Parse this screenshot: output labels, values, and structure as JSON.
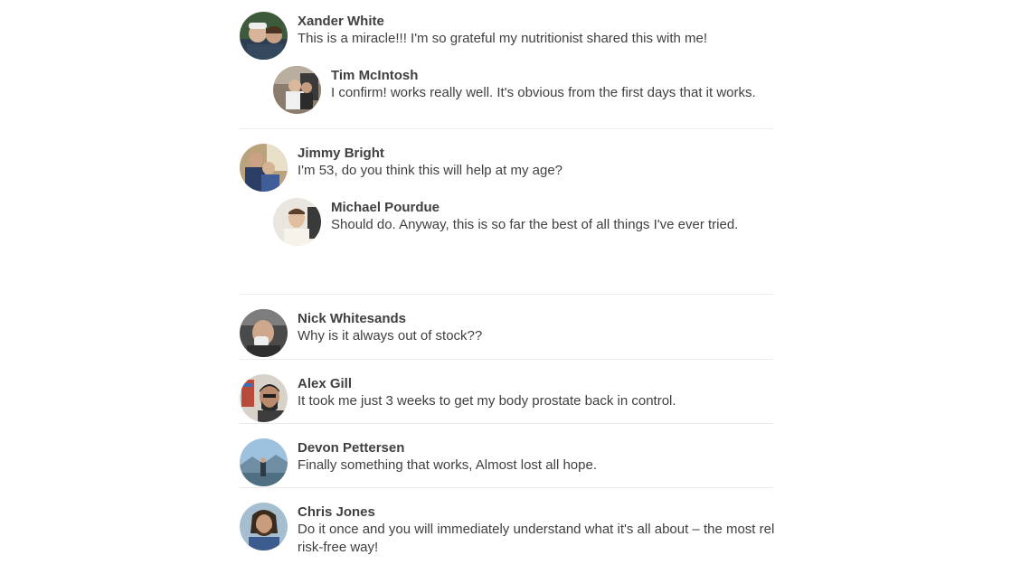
{
  "comments": [
    {
      "name": "Xander White",
      "text": "This is a miracle!!! I'm so grateful my nutritionist shared this with me!",
      "reply": false
    },
    {
      "name": "Tim McIntosh",
      "text": "I confirm! works really well. It's obvious from the first days that it works.",
      "reply": true
    },
    {
      "name": "Jimmy Bright",
      "text": "I'm 53, do you think this will help at my age?",
      "reply": false
    },
    {
      "name": "Michael Pourdue",
      "text": "Should do. Anyway, this is so far the best of all things I've ever tried.",
      "reply": true
    },
    {
      "name": "Nick Whitesands",
      "text": "Why is it always out of stock??",
      "reply": false
    },
    {
      "name": "Alex Gill",
      "text": "It took me just 3 weeks to get my body prostate back in control.",
      "reply": false
    },
    {
      "name": "Devon Pettersen",
      "text": "Finally something that works, Almost lost all hope.",
      "reply": false
    },
    {
      "name": "Chris Jones",
      "text_line1": "Do it once and you will immediately understand what it's all about – the most rel",
      "text_line2": "risk-free way!",
      "reply": false
    }
  ]
}
